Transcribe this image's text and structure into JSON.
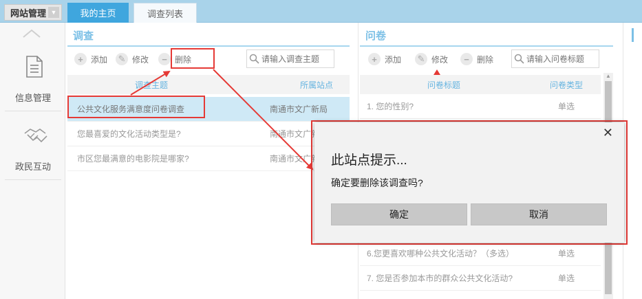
{
  "header": {
    "site_select": "网站管理",
    "tabs": [
      {
        "label": "我的主页"
      },
      {
        "label": "调查列表"
      }
    ]
  },
  "sidebar": {
    "items": [
      {
        "label": "信息管理",
        "icon": "document-icon"
      },
      {
        "label": "政民互动",
        "icon": "handshake-icon"
      }
    ]
  },
  "survey_panel": {
    "title": "调查",
    "toolbar": {
      "add": "添加",
      "edit": "修改",
      "delete": "删除"
    },
    "search_placeholder": "请输入调查主题",
    "columns": [
      "调查主题",
      "所属站点"
    ],
    "rows": [
      {
        "subject": "公共文化服务满意度问卷调查",
        "site": "南通市文广新局"
      },
      {
        "subject": "您最喜爱的文化活动类型是?",
        "site": "南通市文广新"
      },
      {
        "subject": "市区您最满意的电影院是哪家?",
        "site": "南通市文广新"
      }
    ]
  },
  "questionnaire_panel": {
    "title": "问卷",
    "toolbar": {
      "add": "添加",
      "edit": "修改",
      "delete": "删除"
    },
    "search_placeholder": "请输入问卷标题",
    "columns": [
      "问卷标题",
      "问卷类型"
    ],
    "rows": [
      {
        "title": "1. 您的性别?",
        "type": "单选"
      },
      {
        "title": "6.您更喜欢哪种公共文化活动？（多选）",
        "type": "单选"
      },
      {
        "title": "7. 您是否参加本市的群众公共文化活动?",
        "type": "单选"
      }
    ]
  },
  "dialog": {
    "title": "此站点提示...",
    "message": "确定要删除该调查吗?",
    "ok": "确定",
    "cancel": "取消"
  },
  "colors": {
    "accent": "#3fa6de",
    "annotation": "#e53935",
    "selected_row": "#cfe9f6"
  }
}
